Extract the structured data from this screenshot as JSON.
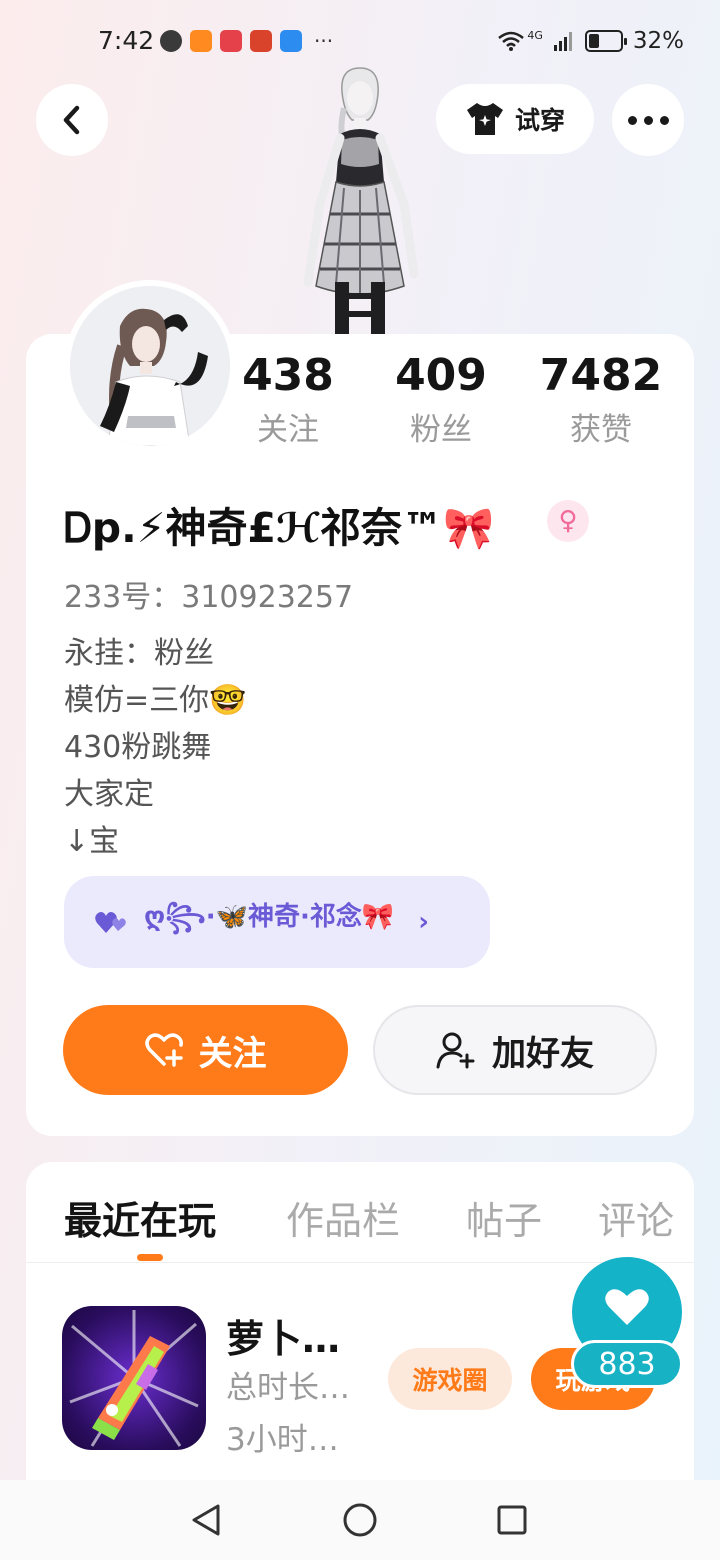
{
  "status_bar": {
    "time": "7:42",
    "more": "···",
    "network": "4G",
    "battery_text": "32%",
    "battery_level": 0.32,
    "app_icons": [
      "wechat-icon",
      "video-icon",
      "reader-icon",
      "game-icon",
      "cloud-icon"
    ]
  },
  "header": {
    "try_on_label": "试穿"
  },
  "stats": [
    {
      "value": "438",
      "label": "关注"
    },
    {
      "value": "409",
      "label": "粉丝"
    },
    {
      "value": "7482",
      "label": "获赞"
    }
  ],
  "profile": {
    "nickname": "Ꭰp.⚡神奇£ℋ祁奈™🎀",
    "gender_symbol": "♀",
    "uid_text": "233号：310923257",
    "bio_lines": [
      "永挂：粉丝",
      "模仿=三你🤓",
      "430粉跳舞",
      "大家定",
      "↓宝"
    ],
    "group_pill_text": "ღ꧂·🦋神奇·祁念🎀"
  },
  "actions": {
    "follow_label": "关注",
    "add_friend_label": "加好友"
  },
  "tabs": [
    {
      "label": "最近在玩",
      "active": true
    },
    {
      "label": "作品栏",
      "active": false
    },
    {
      "label": "帖子",
      "active": false
    },
    {
      "label": "评论",
      "active": false
    }
  ],
  "recent_game": {
    "title": "萝卜…",
    "meta_line1": "总时长…",
    "meta_line2": "3小时…",
    "circle_chip": "游戏圈",
    "play_chip": "玩游戏"
  },
  "like_fab": {
    "count": "883"
  },
  "colors": {
    "accent_orange": "#ff7a19",
    "like_teal": "#14b3c8",
    "group_purple": "#6a5ad6"
  }
}
